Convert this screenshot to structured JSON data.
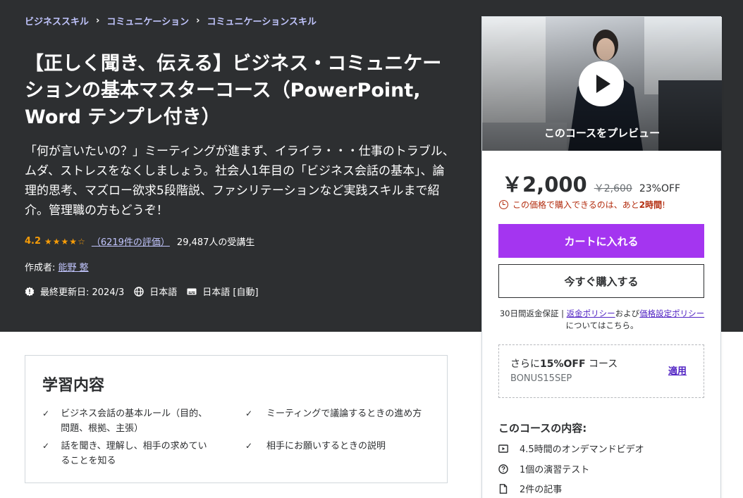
{
  "breadcrumb": {
    "items": [
      "ビジネススキル",
      "コミュニケーション",
      "コミュニケーションスキル"
    ],
    "separator": "›"
  },
  "course": {
    "title": "【正しく聞き、伝える】ビジネス・コミュニケーションの基本マスターコース（PowerPoint, Word テンプレ付き）",
    "subtitle": "「何が言いたいの？」ミーティングが進まず、イライラ・・・仕事のトラブル、ムダ、ストレスをなくしましょう。社会人1年目の「ビジネス会話の基本」、論理的思考、マズロー欲求5段階説、ファシリテーションなど実践スキルまで紹介。管理職の方もどうぞ！",
    "rating": "4.2",
    "stars": "★★★★☆",
    "rating_count": "（6219件の評価）",
    "students": "29,487人の受講生",
    "author_label": "作成者:",
    "author_name": "能野 整",
    "last_updated": "最終更新日: 2024/3",
    "language": "日本語",
    "captions": "日本語 [自動]"
  },
  "learn": {
    "title": "学習内容",
    "items": [
      "ビジネス会話の基本ルール（目的、問題、根拠、主張）",
      "ミーティングで議論するときの進め方",
      "話を聞き、理解し、相手の求めていることを知る",
      "相手にお願いするときの説明"
    ],
    "check": "✓"
  },
  "sidebar": {
    "preview_label": "このコースをプレビュー",
    "price": "￥2,000",
    "original_price": "￥2,600",
    "discount": "23%OFF",
    "timer_prefix": "この価格で購入できるのは、あと",
    "timer_bold": "2時間",
    "timer_suffix": "!",
    "cart_button": "カートに入れる",
    "buy_button": "今すぐ購入する",
    "guarantee_prefix": "30日間返金保証 | ",
    "refund_link": "返金ポリシー",
    "guarantee_and": "および",
    "pricing_link": "価格設定ポリシー",
    "guarantee_suffix": "についてはこちら。",
    "coupon_prefix": "さらに",
    "coupon_bold": "15%OFF",
    "coupon_suffix": " コース",
    "coupon_code": "BONUS15SEP",
    "coupon_apply": "適用",
    "includes_title": "このコースの内容:",
    "includes": [
      "4.5時間のオンデマンドビデオ",
      "1個の演習テスト",
      "2件の記事"
    ]
  },
  "colors": {
    "hero_bg": "#2d2f31",
    "accent_purple": "#a435f0",
    "link_purple": "#5022c3",
    "star_orange": "#f69c08",
    "timer_red": "#b32d0f"
  }
}
